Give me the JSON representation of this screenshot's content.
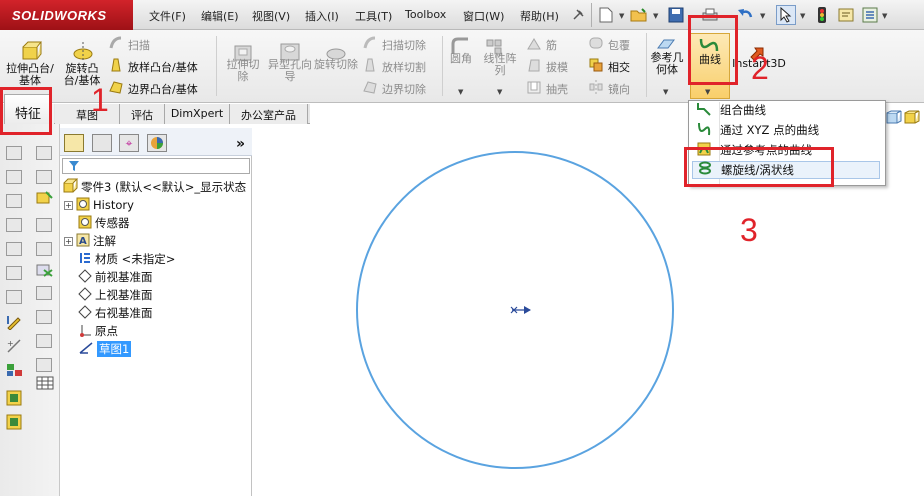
{
  "app": {
    "logo": "SOLIDWORKS"
  },
  "menu": [
    "文件(F)",
    "编辑(E)",
    "视图(V)",
    "插入(I)",
    "工具(T)",
    "Toolbox",
    "窗口(W)",
    "帮助(H)"
  ],
  "ribbon": {
    "extrude_boss": "拉伸凸台/基体",
    "revolve_boss": "旋转凸台/基体",
    "sweep": "扫描",
    "loft": "放样凸台/基体",
    "boundary": "边界凸台/基体",
    "extrude_cut": "拉伸切除",
    "hole_wizard": "异型孔向导",
    "revolve_cut": "旋转切除",
    "sweep_cut": "扫描切除",
    "loft_cut": "放样切割",
    "boundary_cut": "边界切除",
    "fillet": "圆角",
    "linear_pattern": "线性阵列",
    "rib": "筋",
    "draft": "拔模",
    "shell": "抽壳",
    "wrap": "包覆",
    "intersect": "相交",
    "mirror": "镜向",
    "ref_geometry": "参考几何体",
    "curves": "曲线",
    "instant3d": "Instant3D"
  },
  "left_tab": "特征",
  "tabs": [
    "草图",
    "评估",
    "DimXpert",
    "办公室产品"
  ],
  "tree": {
    "root": "零件3 (默认<<默认>_显示状态",
    "items": [
      "History",
      "传感器",
      "注解",
      "材质 <未指定>",
      "前视基准面",
      "上视基准面",
      "右视基准面",
      "原点",
      "草图1"
    ]
  },
  "curves_menu": [
    "组合曲线",
    "通过 XYZ 点的曲线",
    "通过参考点的曲线",
    "螺旋线/涡状线"
  ],
  "annotations": [
    "1",
    "2",
    "3"
  ],
  "colors": {
    "accent": "#e0232a",
    "selection": "#3399ff",
    "circle": "#5aa3e0"
  }
}
